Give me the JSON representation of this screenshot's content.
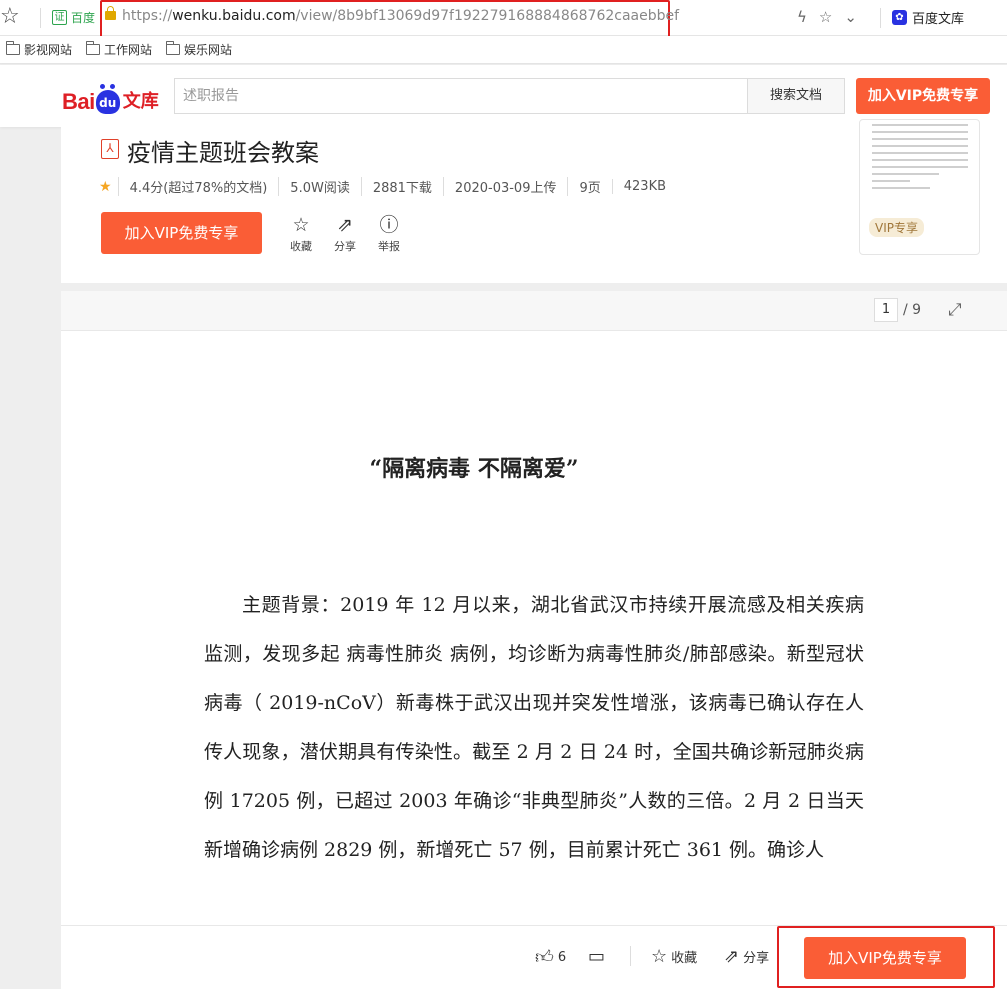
{
  "browser": {
    "cert_label": "证",
    "cert_name": "百度",
    "url_prefix": "https://",
    "url_domain": "wenku.baidu.com",
    "url_path": "/view/8b9bf13069d97f192279168884868762caaebbef",
    "profile_label": "百度文库"
  },
  "bookmarks": [
    {
      "label": "影视网站"
    },
    {
      "label": "工作网站"
    },
    {
      "label": "娱乐网站"
    }
  ],
  "header": {
    "logo_bai": "Bai",
    "logo_du": "du",
    "logo_wenku": "文库",
    "search_placeholder": "述职报告",
    "search_button": "搜索文档",
    "vip_button": "加入VIP免费专享"
  },
  "doc_info": {
    "title": "疫情主题班会教案",
    "rating": "4.4分",
    "rating_note": "(超过78%的文档)",
    "reads": "5.0W阅读",
    "downloads": "2881下载",
    "upload_date": "2020-03-09上传",
    "pages": "9页",
    "size": "423KB",
    "vip_button": "加入VIP免费专享",
    "actions": [
      {
        "label": "收藏",
        "icon": "star-outline-icon"
      },
      {
        "label": "分享",
        "icon": "share-icon"
      },
      {
        "label": "举报",
        "icon": "report-icon"
      }
    ],
    "thumbnail_tag": "VIP专享"
  },
  "reader": {
    "current_page": "1",
    "total_pages": "/ 9",
    "heading": "“隔离病毒  不隔离爱”",
    "body": "主题背景：2019 年 12 月以来，湖北省武汉市持续开展流感及相关疾病监测，发现多起 病毒性肺炎 病例，均诊断为病毒性肺炎/肺部感染。新型冠状病毒（ 2019-nCoV）新毒株于武汉出现并突发性增涨，该病毒已确认存在人传人现象，潜伏期具有传染性。截至 2 月 2 日 24 时，全国共确诊新冠肺炎病例  17205 例，已超过 2003 年确诊“非典型肺炎”人数的三倍。2 月 2 日当天新增确诊病例 2829 例，新增死亡 57 例，目前累计死亡 361 例。确诊人"
  },
  "bottom_bar": {
    "like_count": "6",
    "favorite_label": "收藏",
    "share_label": "分享",
    "vip_button": "加入VIP免费专享"
  }
}
